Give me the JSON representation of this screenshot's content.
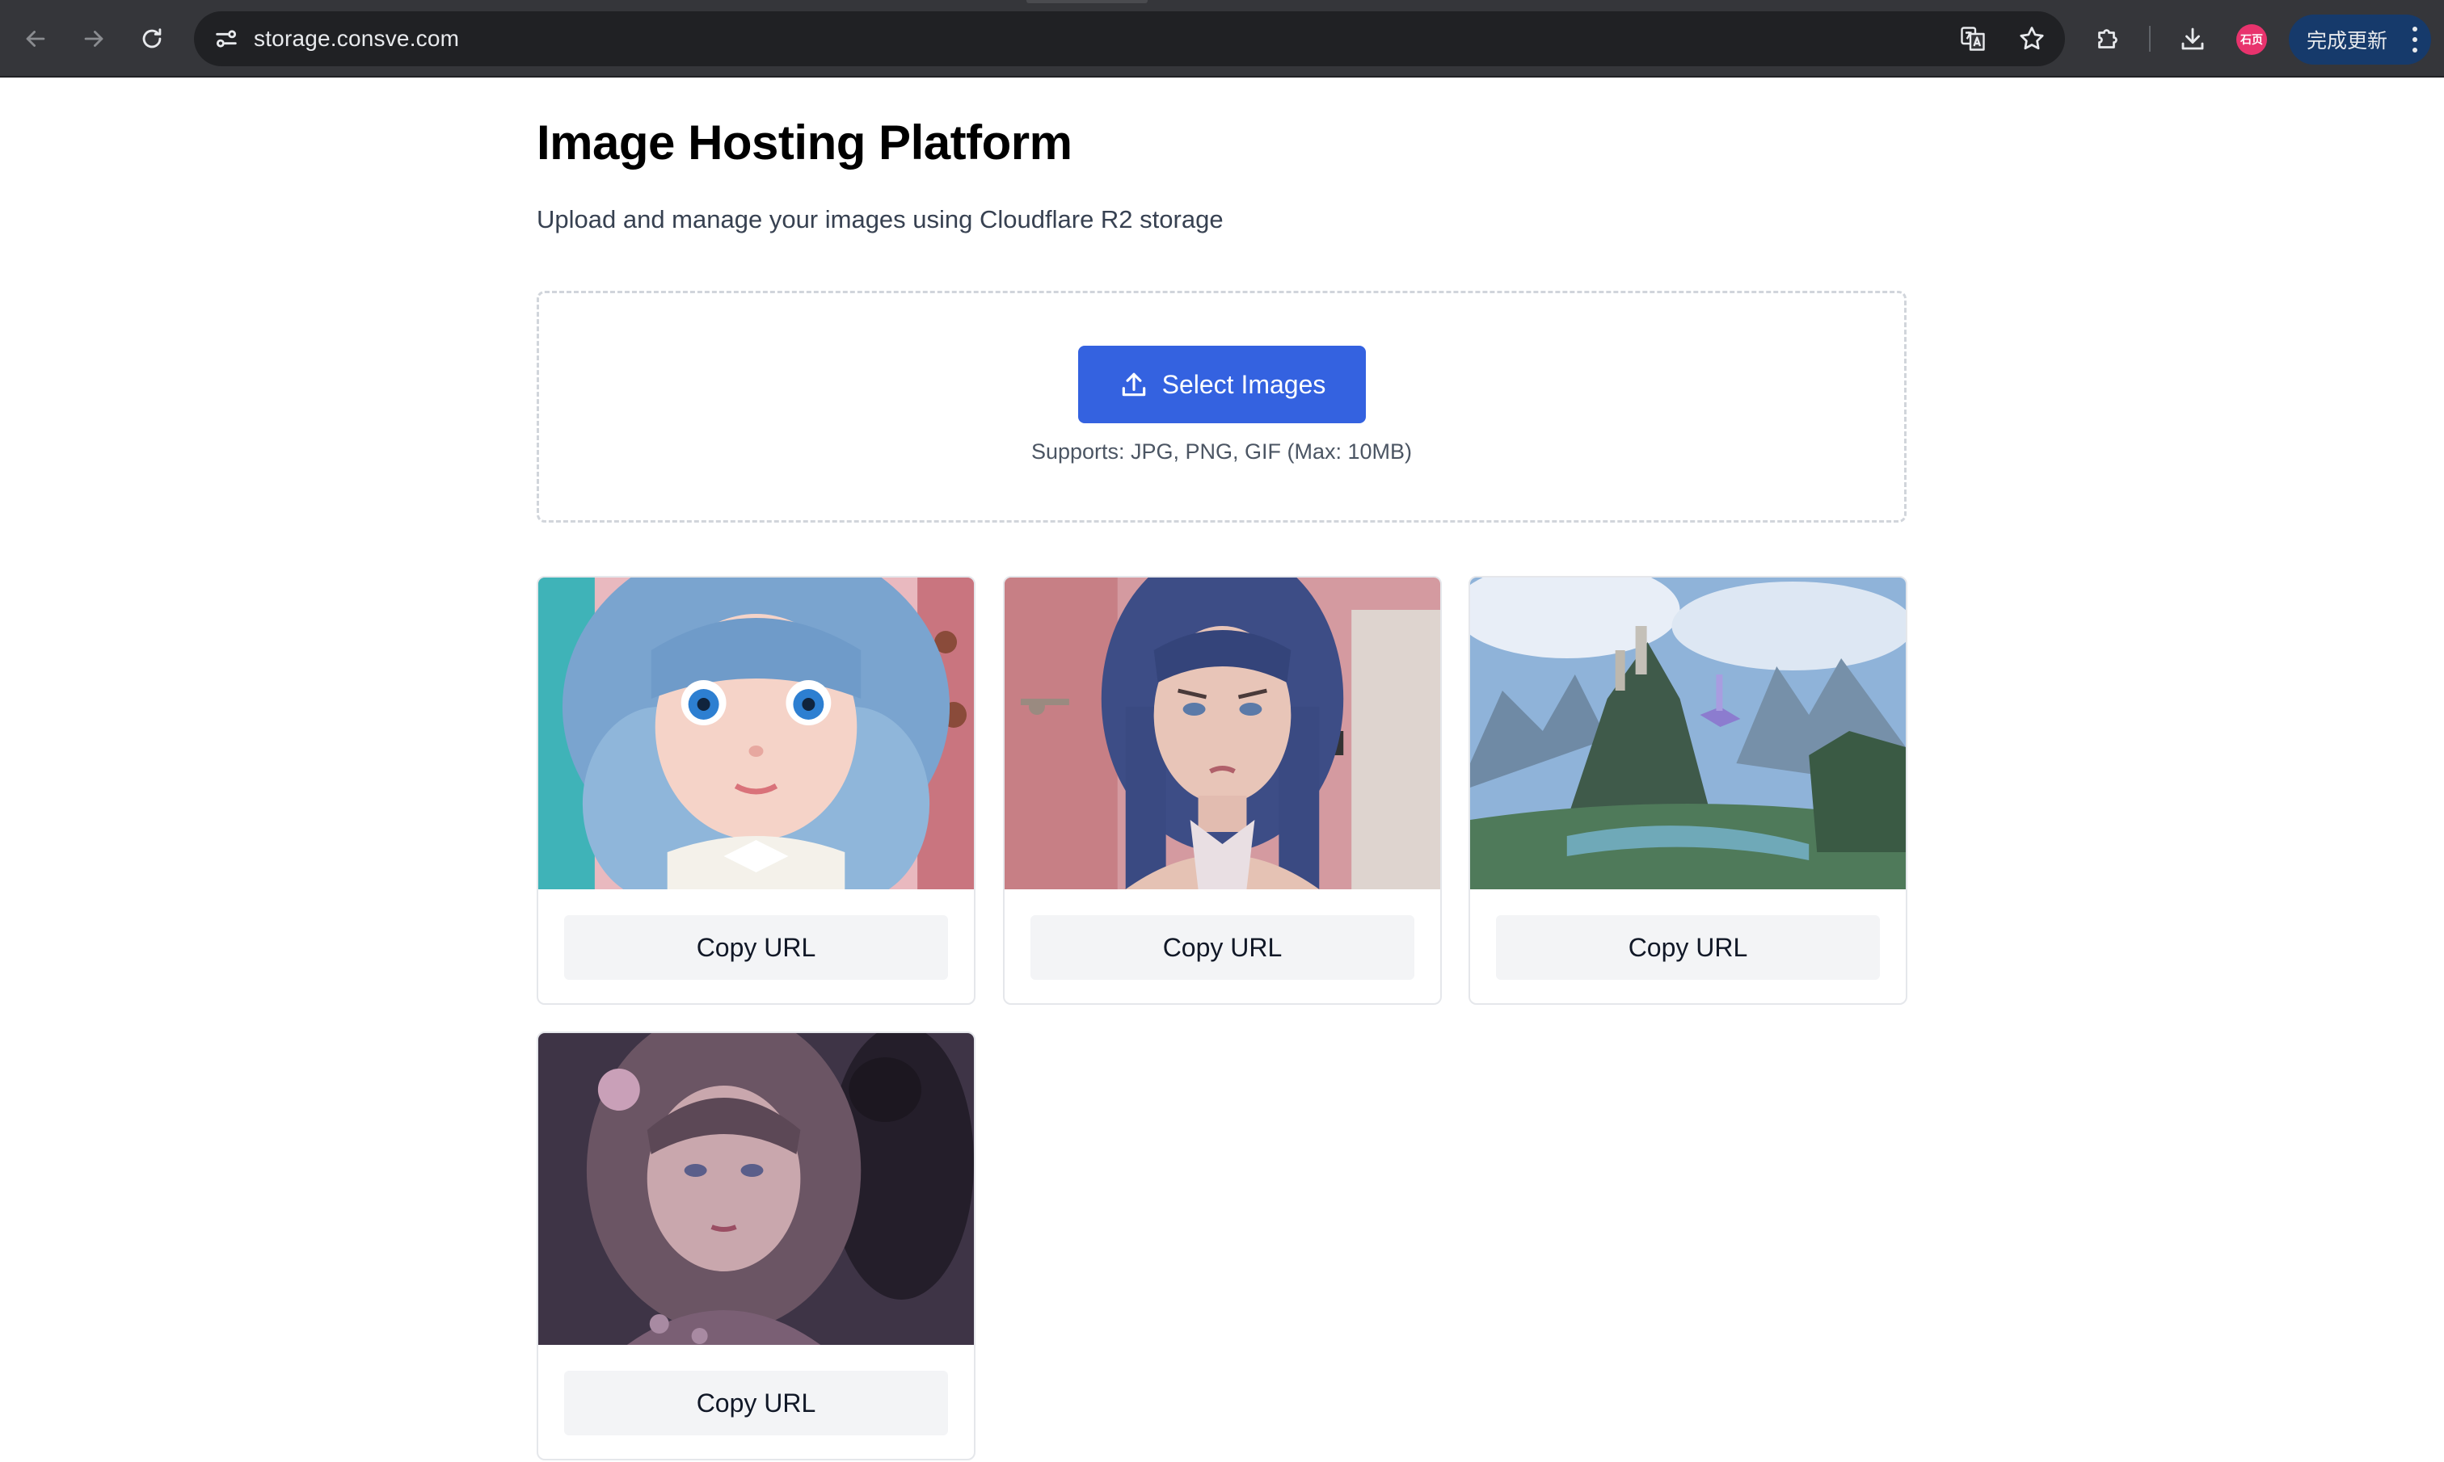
{
  "browser": {
    "url": "storage.consve.com",
    "update_label": "完成更新",
    "avatar_label": "石页",
    "icons": {
      "back": "arrow-left-icon",
      "forward": "arrow-right-icon",
      "reload": "reload-icon",
      "site_info": "tune-icon",
      "translate": "translate-icon",
      "bookmark": "star-icon",
      "extensions": "puzzle-icon",
      "downloads": "download-icon",
      "menu": "more-vertical-icon"
    }
  },
  "page": {
    "title": "Image Hosting Platform",
    "subtitle": "Upload and manage your images using Cloudflare R2 storage"
  },
  "upload": {
    "button_label": "Select Images",
    "button_icon": "upload-icon",
    "supports": "Supports: JPG, PNG, GIF (Max: 10MB)",
    "accent_color": "#3462e0"
  },
  "gallery": {
    "items": [
      {
        "copy_label": "Copy URL"
      },
      {
        "copy_label": "Copy URL"
      },
      {
        "copy_label": "Copy URL"
      },
      {
        "copy_label": "Copy URL"
      }
    ]
  }
}
